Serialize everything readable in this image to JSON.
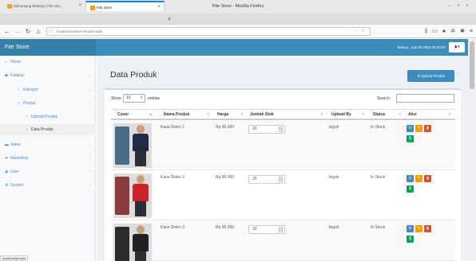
{
  "window": {
    "title": "Fite Store - Mozilla Firefox"
  },
  "tabs": [
    {
      "label": "Menunjang Belanja | Fite Sto..."
    },
    {
      "label": "Fite Store"
    }
  ],
  "address": {
    "url": "localhost/online-shop/produk"
  },
  "app": {
    "brand": "Fite Store",
    "datetime": "Selasa , Juli 30 2019 00:20:57"
  },
  "sidebar": {
    "items": [
      {
        "label": "Home"
      },
      {
        "label": "Katalog"
      },
      {
        "label": "Kategori"
      },
      {
        "label": "Produk"
      },
      {
        "label": "Upload Produk"
      },
      {
        "label": "Data Produk"
      },
      {
        "label": "Sales"
      },
      {
        "label": "Marketing"
      },
      {
        "label": "User"
      },
      {
        "label": "System"
      }
    ]
  },
  "page": {
    "title": "Data Produk",
    "upload_button": "Upload Produk",
    "show_label": "Show",
    "entries_value": "10",
    "entries_label": "entries",
    "search_label": "Search:"
  },
  "table": {
    "headers": [
      "Cover",
      "Nama Produk",
      "Harga",
      "Jumlah Stok",
      "Upload By",
      "Status",
      "Aksi"
    ],
    "rows": [
      {
        "name": "Kaos Distro 1",
        "price": "Rp 95.000",
        "stock": "20",
        "upload_by": "teguh",
        "status": "In Stock"
      },
      {
        "name": "Kaos Distro 2",
        "price": "Rp 95.000",
        "stock": "25",
        "upload_by": "teguh",
        "status": "In Stock"
      },
      {
        "name": "Kaos Distro 3",
        "price": "Rp 95.000",
        "stock": "30",
        "upload_by": "teguh",
        "status": "In Stock"
      }
    ]
  },
  "statusbar": {
    "text": "localhost/produk"
  },
  "colors": {
    "primary": "#3c8dbc",
    "warning": "#f39c12",
    "danger": "#dd4b39",
    "success": "#00a65a"
  },
  "icons": [
    "home-icon",
    "tag-icon",
    "cart-icon",
    "share-icon",
    "user-icon",
    "gears-icon",
    "upload-icon",
    "eye-icon",
    "pencil-icon",
    "trash-icon",
    "dollar-icon"
  ]
}
